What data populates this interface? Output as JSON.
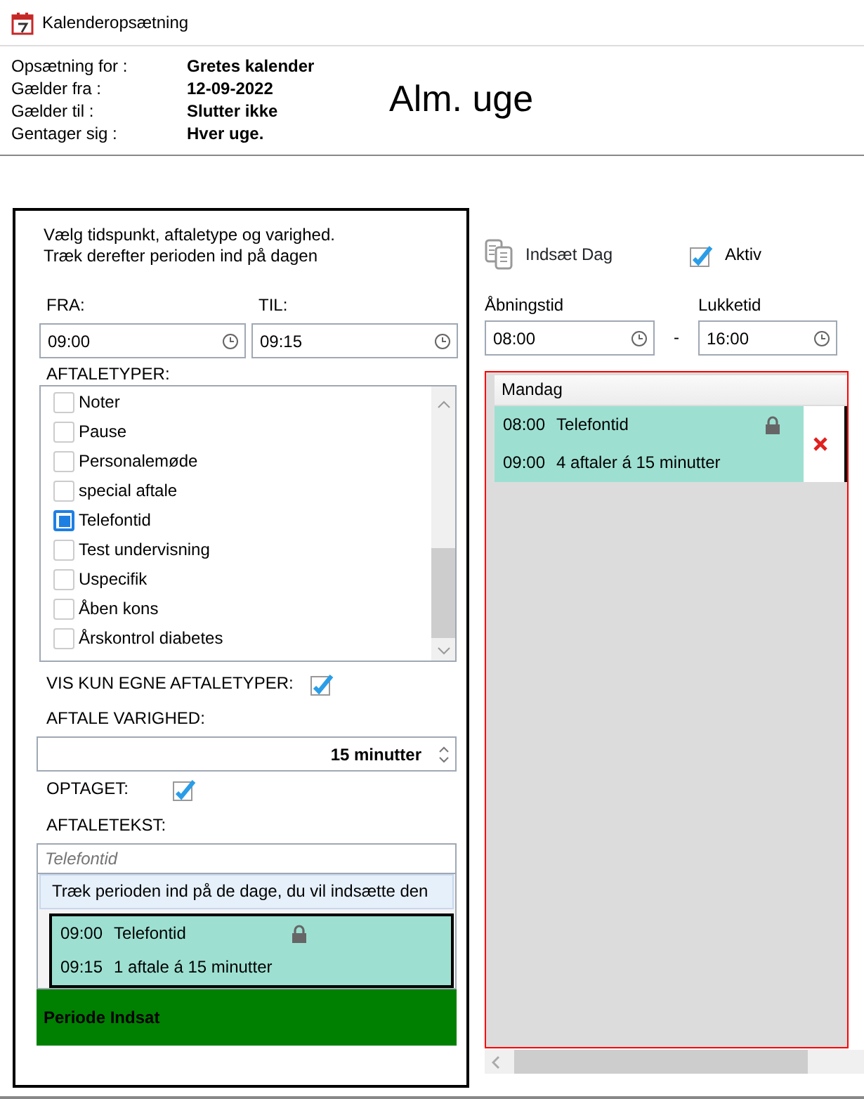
{
  "window": {
    "title": "Kalenderopsætning"
  },
  "summary": {
    "rows": [
      {
        "label": "Opsætning for :",
        "value": "Gretes kalender"
      },
      {
        "label": "Gælder fra :",
        "value": "12-09-2022"
      },
      {
        "label": "Gælder til :",
        "value": "Slutter ikke"
      },
      {
        "label": "Gentager sig :",
        "value": "Hver uge."
      }
    ],
    "heading": "Alm. uge"
  },
  "period_panel": {
    "instructions": [
      "Vælg tidspunkt, aftaletype og varighed.",
      "Træk derefter perioden ind på dagen"
    ],
    "from": {
      "label": "FRA:",
      "value": "09:00"
    },
    "to": {
      "label": "TIL:",
      "value": "09:15"
    },
    "types_label": "AFTALETYPER:",
    "types": [
      {
        "label": "Noter",
        "checked": false
      },
      {
        "label": "Pause",
        "checked": false
      },
      {
        "label": "Personalemøde",
        "checked": false
      },
      {
        "label": "special aftale",
        "checked": false
      },
      {
        "label": "Telefontid",
        "checked": true
      },
      {
        "label": "Test undervisning",
        "checked": false
      },
      {
        "label": "Uspecifik",
        "checked": false
      },
      {
        "label": "Åben kons",
        "checked": false
      },
      {
        "label": "Årskontrol diabetes",
        "checked": false
      }
    ],
    "own_types": {
      "label": "VIS KUN EGNE AFTALETYPER:",
      "checked": true
    },
    "duration": {
      "label": "AFTALE VARIGHED:",
      "value": "15 minutter"
    },
    "busy": {
      "label": "OPTAGET:",
      "checked": true
    },
    "text": {
      "label": "AFTALETEKST:",
      "placeholder": "Telefontid"
    },
    "drag_hint": "Træk perioden ind på de dage, du vil indsætte den",
    "preview": {
      "start": "09:00",
      "title": "Telefontid",
      "end": "09:15",
      "summary": "1 aftale á 15 minutter",
      "locked": true
    },
    "status": "Periode Indsat"
  },
  "day_panel": {
    "insert_day": "Indsæt Dag",
    "active": {
      "label": "Aktiv",
      "checked": true
    },
    "opening": {
      "label": "Åbningstid",
      "value": "08:00"
    },
    "separator": "-",
    "closing": {
      "label": "Lukketid",
      "value": "16:00"
    },
    "day": {
      "name": "Mandag",
      "entries": [
        {
          "start": "08:00",
          "title": "Telefontid",
          "end": "09:00",
          "summary": "4 aftaler á 15 minutter",
          "locked": true
        }
      ]
    }
  }
}
